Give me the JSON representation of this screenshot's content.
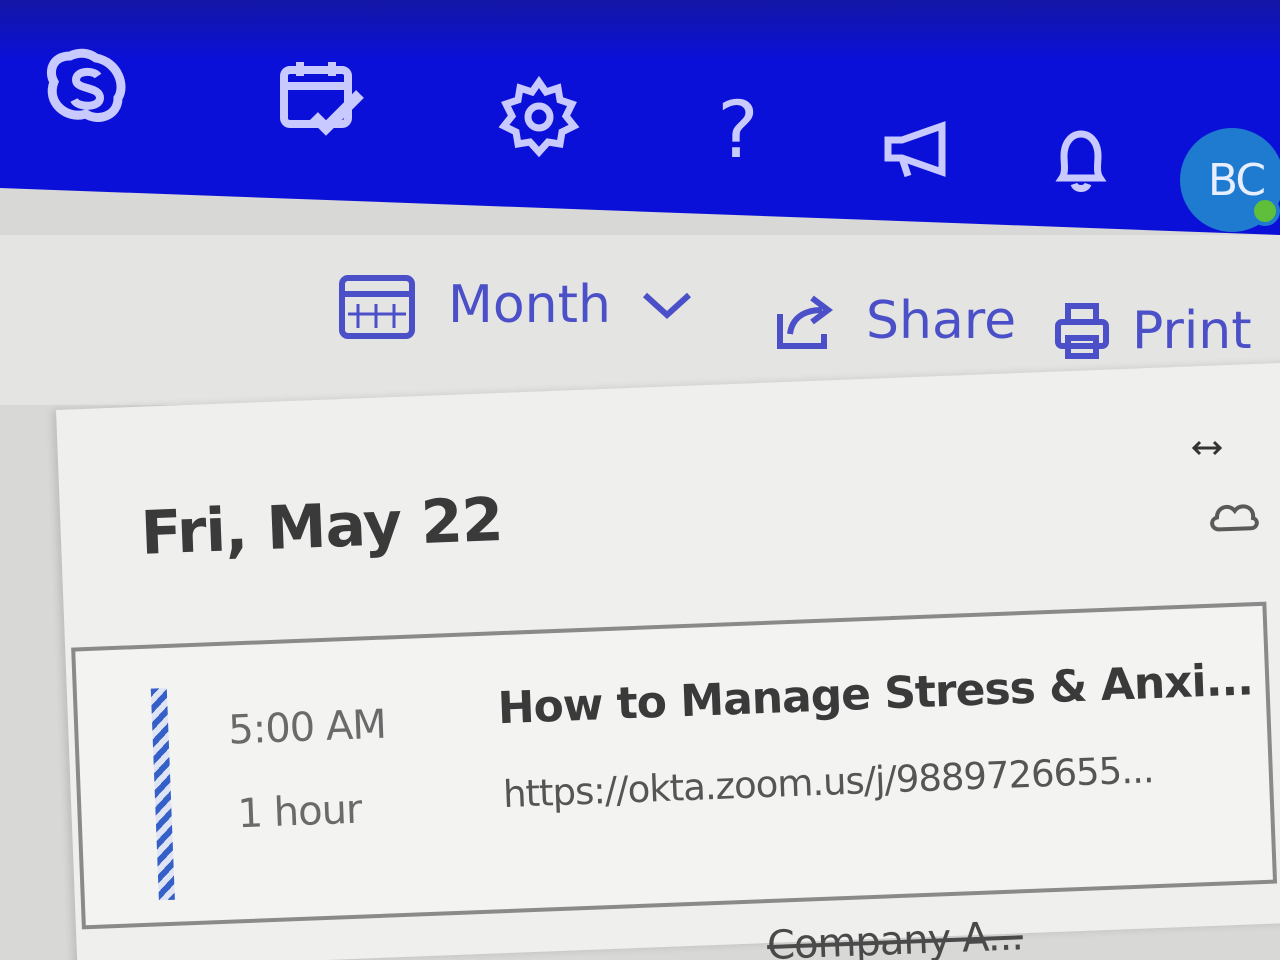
{
  "topbar": {
    "icons": [
      "skype-icon",
      "todo-icon",
      "settings-icon",
      "help-icon",
      "megaphone-icon",
      "bell-icon"
    ],
    "help_glyph": "?",
    "avatar_initials": "BC",
    "presence": "available"
  },
  "commandbar": {
    "view_label": "Month",
    "share_label": "Share",
    "print_label": "Print"
  },
  "agenda": {
    "date_heading": "Fri, May 22",
    "events": [
      {
        "time": "5:00 AM",
        "duration": "1 hour",
        "title": "How to Manage Stress & Anxi...",
        "location": "https://okta.zoom.us/j/9889726655..."
      }
    ],
    "next_event_title": "Company A..."
  },
  "colors": {
    "topbar": "#0b10d8",
    "accent": "#4c50c8",
    "avatar": "#1f7bd0",
    "presence": "#5fbf3a",
    "event_stripe": "#3560c8"
  }
}
